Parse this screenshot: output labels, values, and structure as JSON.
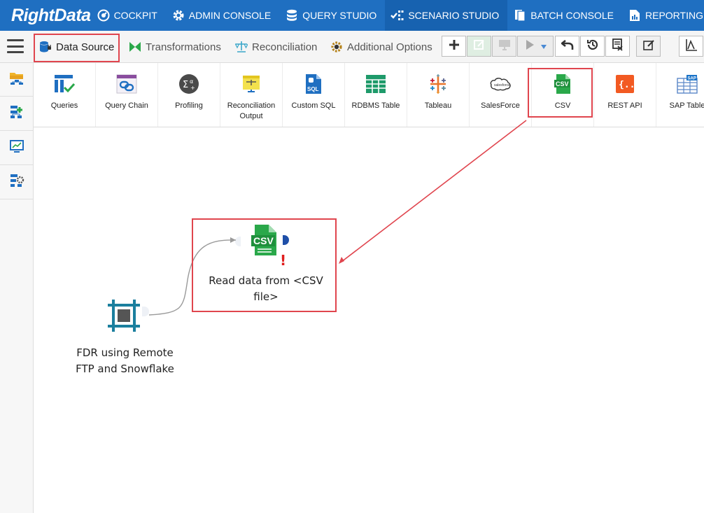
{
  "app": {
    "logo": "RightData"
  },
  "nav": {
    "items": [
      {
        "label": "COCKPIT",
        "icon": "cockpit-icon"
      },
      {
        "label": "ADMIN CONSOLE",
        "icon": "gear-icon"
      },
      {
        "label": "QUERY STUDIO",
        "icon": "database-icon"
      },
      {
        "label": "SCENARIO STUDIO",
        "icon": "scenario-icon",
        "active": true
      },
      {
        "label": "BATCH CONSOLE",
        "icon": "batch-icon"
      },
      {
        "label": "REPORTING",
        "icon": "report-icon"
      }
    ]
  },
  "toolbar": {
    "tabs": [
      {
        "label": "Data Source",
        "icon": "database-plug-icon",
        "active": true
      },
      {
        "label": "Transformations",
        "icon": "bowtie-icon"
      },
      {
        "label": "Reconciliation",
        "icon": "scale-icon"
      },
      {
        "label": "Additional Options",
        "icon": "gear-icon"
      }
    ]
  },
  "palette": {
    "items": [
      {
        "label": "Queries",
        "icon": "queries-icon"
      },
      {
        "label": "Query Chain",
        "icon": "chain-icon"
      },
      {
        "label": "Profiling",
        "icon": "sigma-icon"
      },
      {
        "label": "Reconciliation Output",
        "icon": "reconciliation-icon"
      },
      {
        "label": "Custom SQL",
        "icon": "sql-file-icon"
      },
      {
        "label": "RDBMS Table",
        "icon": "table-icon"
      },
      {
        "label": "Tableau",
        "icon": "tableau-icon"
      },
      {
        "label": "SalesForce",
        "icon": "salesforce-icon"
      },
      {
        "label": "CSV",
        "icon": "csv-icon",
        "highlighted": true
      },
      {
        "label": "REST API",
        "icon": "rest-api-icon"
      },
      {
        "label": "SAP Table",
        "icon": "sap-table-icon"
      }
    ]
  },
  "canvas": {
    "csv_node": {
      "badge": "CSV",
      "label": "Read data from <CSV file>",
      "warning": "!"
    },
    "ftp_node": {
      "label": "FDR using Remote FTP and Snowflake"
    }
  },
  "colors": {
    "brand": "#1f6fc1",
    "highlight": "#e0454e",
    "csv_green": "#2aa84a",
    "node_teal": "#1b7f9e"
  }
}
